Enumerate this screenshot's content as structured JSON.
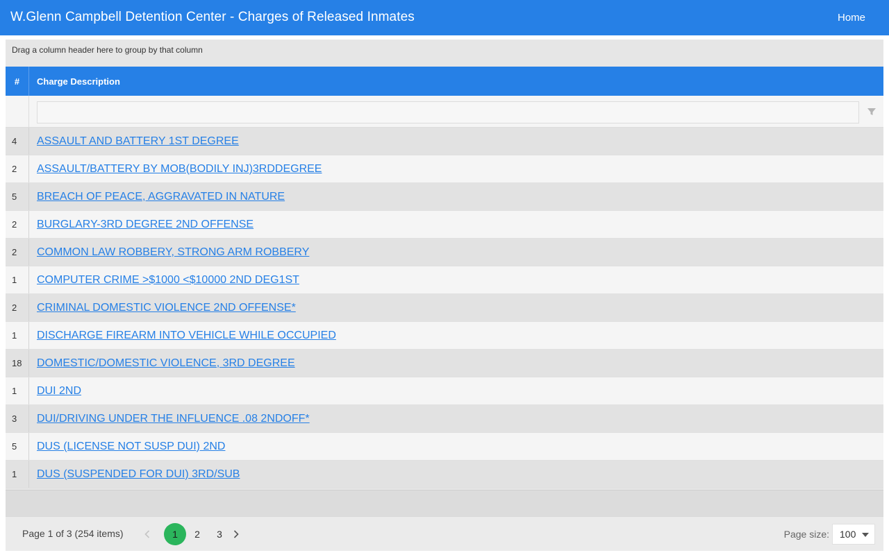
{
  "header": {
    "title": "W.Glenn Campbell Detention Center - Charges of Released Inmates",
    "home_label": "Home"
  },
  "grid": {
    "group_panel_text": "Drag a column header here to group by that column",
    "columns": {
      "count_header": "#",
      "description_header": "Charge Description"
    },
    "filter": {
      "value": ""
    },
    "rows": [
      {
        "count": "4",
        "description": "ASSAULT AND BATTERY 1ST DEGREE"
      },
      {
        "count": "2",
        "description": "ASSAULT/BATTERY BY MOB(BODILY INJ)3RDDEGREE"
      },
      {
        "count": "5",
        "description": "BREACH OF PEACE, AGGRAVATED IN NATURE"
      },
      {
        "count": "2",
        "description": "BURGLARY-3RD DEGREE 2ND OFFENSE"
      },
      {
        "count": "2",
        "description": "COMMON LAW ROBBERY, STRONG ARM ROBBERY"
      },
      {
        "count": "1",
        "description": "COMPUTER CRIME >$1000 <$10000 2ND DEG1ST"
      },
      {
        "count": "2",
        "description": "CRIMINAL DOMESTIC VIOLENCE 2ND OFFENSE*"
      },
      {
        "count": "1",
        "description": "DISCHARGE FIREARM INTO VEHICLE WHILE OCCUPIED"
      },
      {
        "count": "18",
        "description": "DOMESTIC/DOMESTIC VIOLENCE, 3RD DEGREE"
      },
      {
        "count": "1",
        "description": "DUI 2ND"
      },
      {
        "count": "3",
        "description": "DUI/DRIVING UNDER THE INFLUENCE .08 2NDOFF*"
      },
      {
        "count": "5",
        "description": "DUS (LICENSE NOT SUSP DUI) 2ND"
      },
      {
        "count": "1",
        "description": "DUS (SUSPENDED FOR DUI) 3RD/SUB"
      }
    ]
  },
  "pager": {
    "info": "Page 1 of 3 (254 items)",
    "pages": [
      "1",
      "2",
      "3"
    ],
    "current_page": "1",
    "page_size_label": "Page size:",
    "page_size": "100"
  },
  "colors": {
    "accent": "#2680e6",
    "active_page": "#2bb55c",
    "link": "#2680e6"
  },
  "icons": {
    "filter": "filter-icon",
    "prev": "chevron-left-icon",
    "next": "chevron-right-icon",
    "dropdown": "caret-down-icon"
  }
}
